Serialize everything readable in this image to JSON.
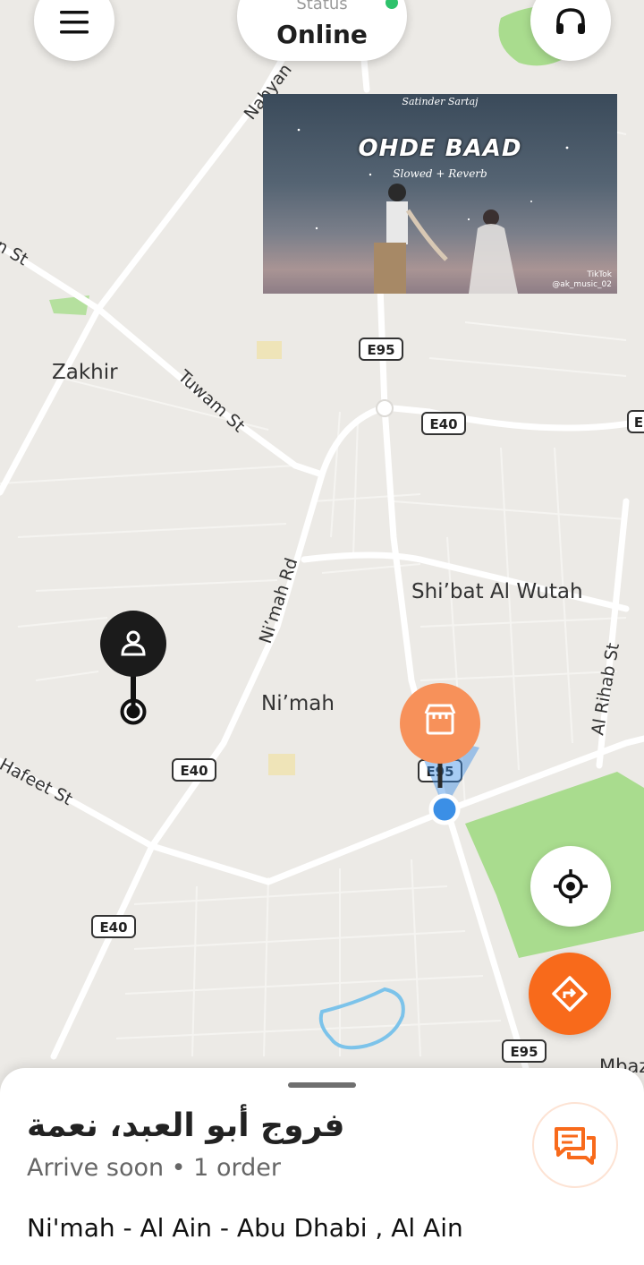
{
  "status": {
    "label": "Status",
    "value": "Online"
  },
  "map_labels": {
    "zakhir": "Zakhir",
    "tuwam_st": "Tuwam St",
    "nahyan": "Nahyan",
    "st_left": "n St",
    "nimah_rd": "Ni’mah Rd",
    "nimah": "Ni’mah",
    "shibat": "Shi’bat Al Wutah",
    "al_rihab": "Al Rihab St",
    "hafeet": "Hafeet St",
    "mbaz": "Mbaz",
    "e95_top": "E95",
    "e40_mid": "E40",
    "e40_left": "E40",
    "e40_low": "E40",
    "e95_partial": "E95",
    "e95_bottom": "E95",
    "e_right": "E"
  },
  "video": {
    "artist": "Satinder Sartaj",
    "song": "OHDE BAAD",
    "subtitle": "Slowed + Reverb",
    "watermark": "TikTok",
    "handle": "@ak_music_02"
  },
  "order": {
    "store_name": "فروج أبو العبد، نعمة",
    "eta": "Arrive soon • 1 order",
    "address": "Ni'mah - Al Ain - Abu Dhabi , Al Ain"
  },
  "icons": {
    "menu": "hamburger-menu-icon",
    "support": "headset-icon",
    "recenter": "crosshair-target-icon",
    "navigate": "navigation-diamond-icon",
    "store": "storefront-icon",
    "customer": "person-icon",
    "chat": "chat-bubbles-icon"
  },
  "colors": {
    "accent": "#f86a1b",
    "store_pin": "#f7915a",
    "online": "#2ec26b",
    "location": "#3b8fe6",
    "park": "#a9dc8e"
  }
}
